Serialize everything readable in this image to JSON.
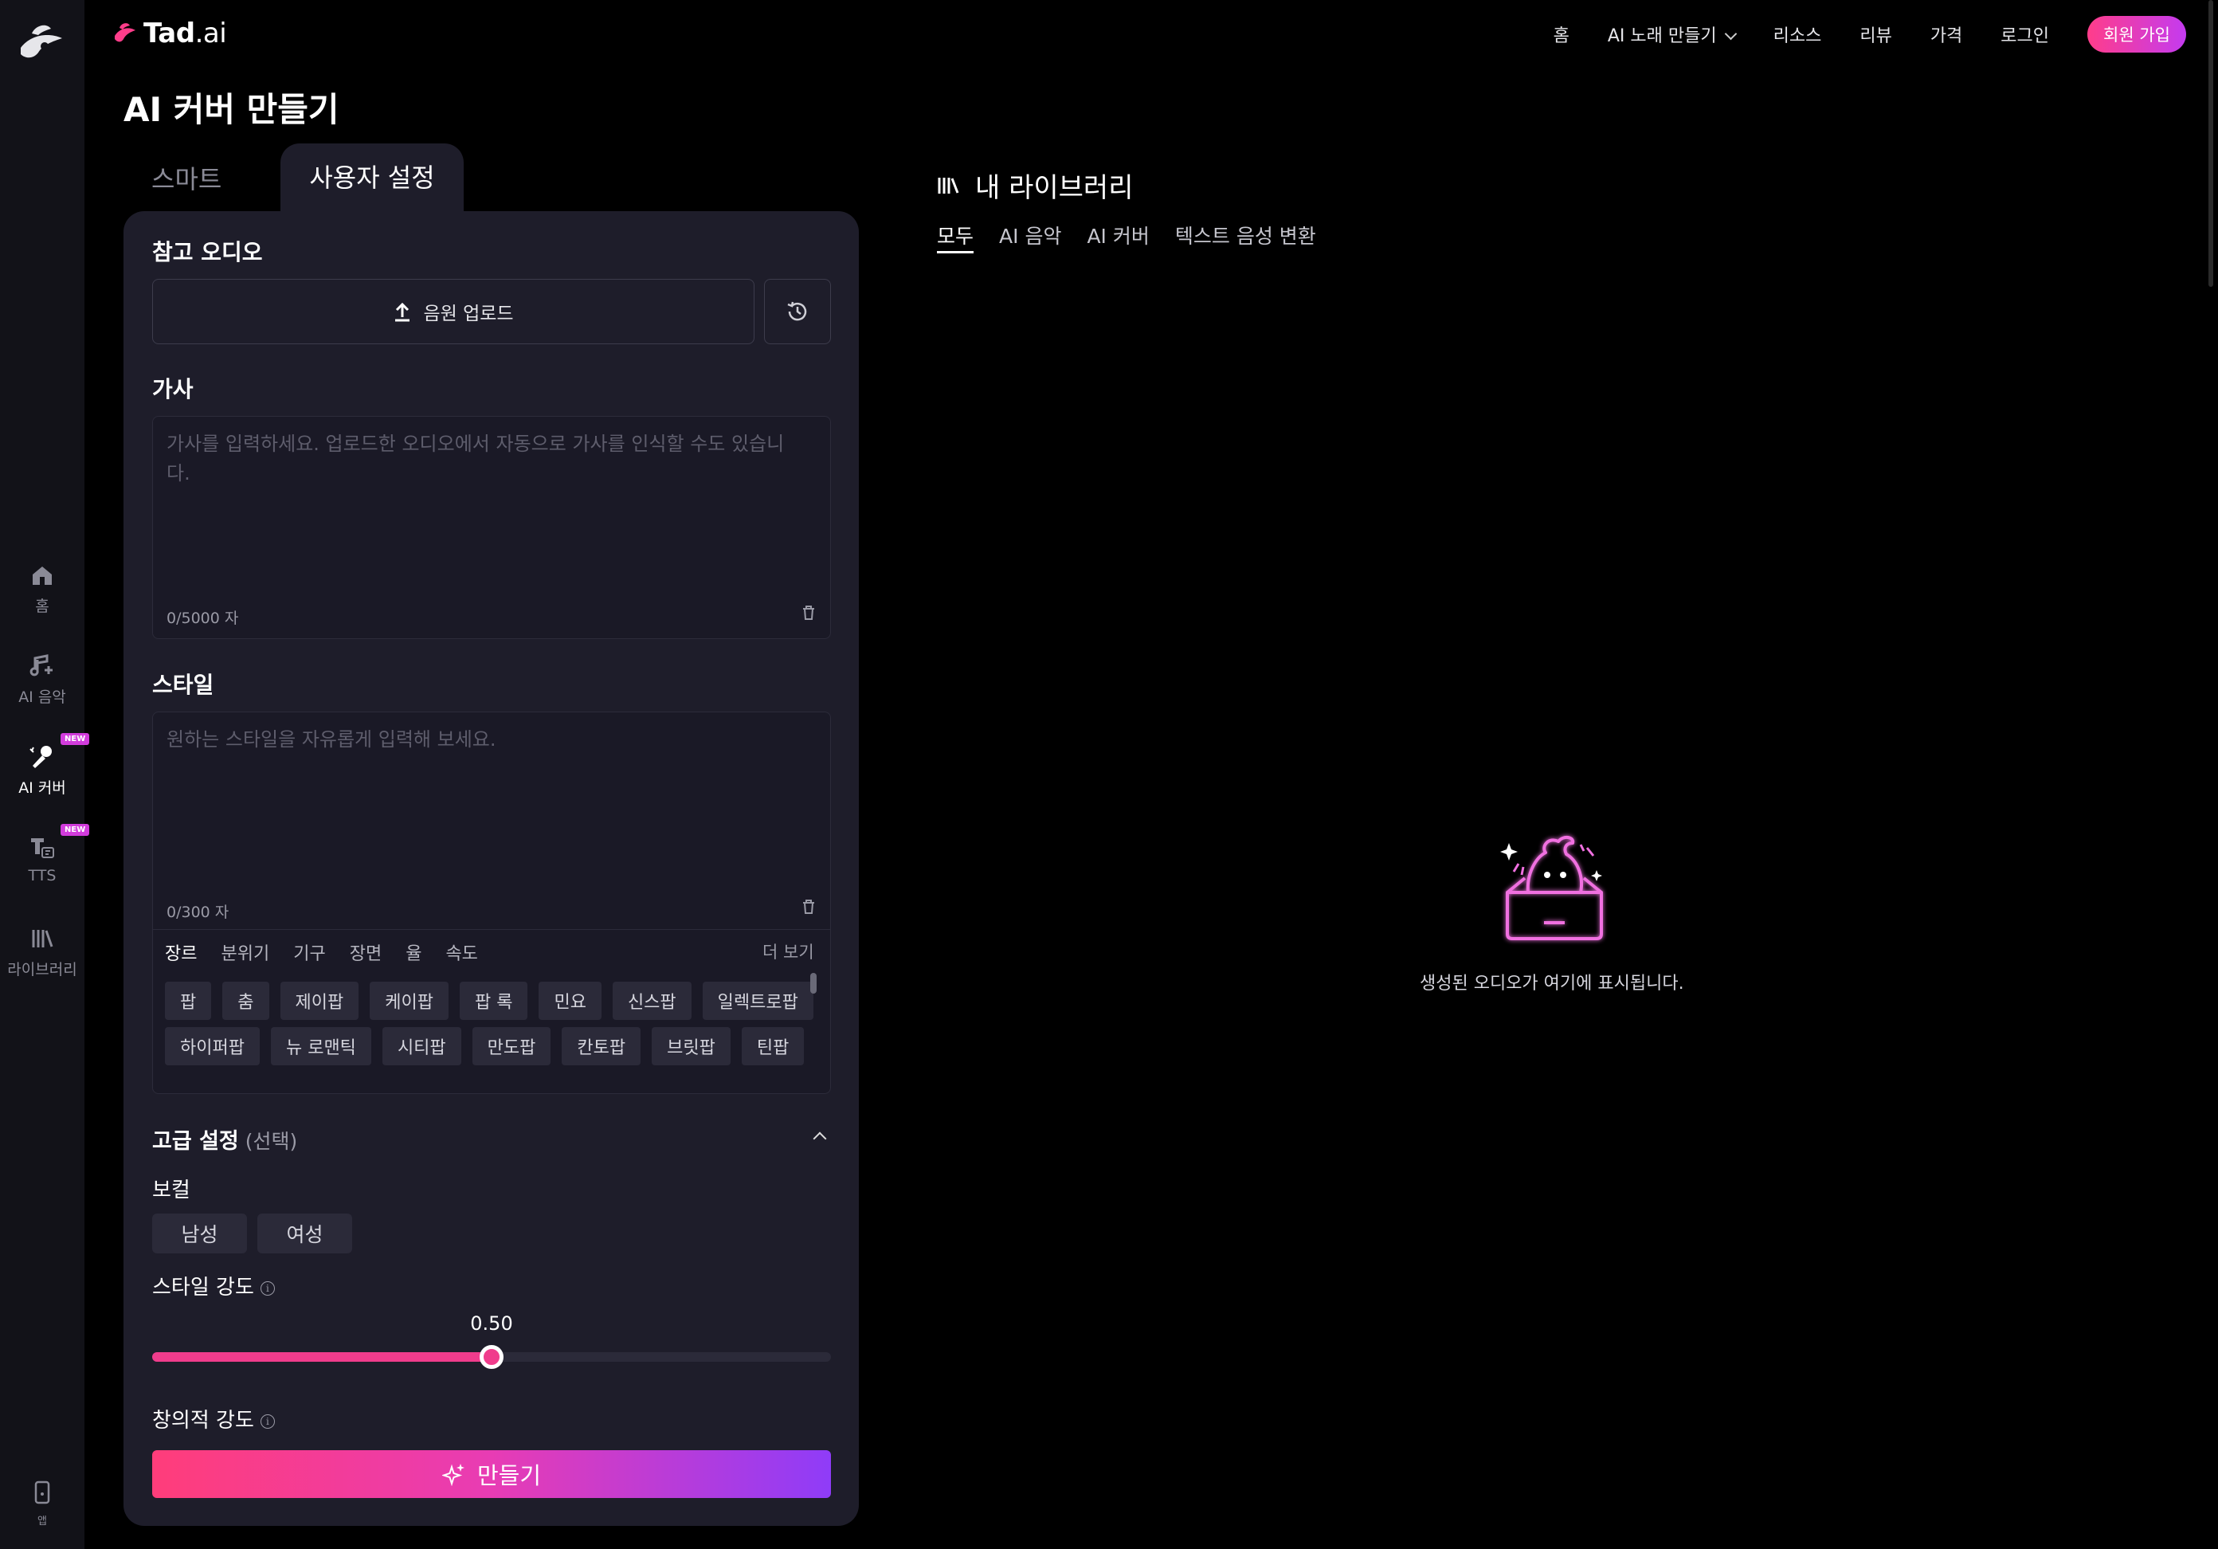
{
  "brand": {
    "name": "Tad",
    "suffix": ".ai"
  },
  "nav": {
    "home": "홈",
    "ai_song": "AI 노래 만들기",
    "resources": "리소스",
    "reviews": "리뷰",
    "pricing": "가격",
    "login": "로그인",
    "signup": "회원 가입"
  },
  "sidebar": {
    "items": [
      {
        "label": "홈",
        "icon": "home-icon"
      },
      {
        "label": "AI 음악",
        "icon": "music-note-icon"
      },
      {
        "label": "AI 커버",
        "icon": "microphone-icon",
        "badge": "NEW"
      },
      {
        "label": "TTS",
        "icon": "tts-icon",
        "badge": "NEW"
      },
      {
        "label": "라이브러리",
        "icon": "library-icon"
      }
    ],
    "app_label": "앱"
  },
  "page": {
    "title": "AI 커버 만들기"
  },
  "mode_tabs": {
    "smart": "스마트",
    "custom": "사용자 설정"
  },
  "form": {
    "reference_audio": {
      "label": "참고 오디오",
      "upload": "음원 업로드"
    },
    "lyrics": {
      "label": "가사",
      "placeholder": "가사를 입력하세요. 업로드한 오디오에서 자동으로 가사를 인식할 수도 있습니다.",
      "counter": "0/5000 자"
    },
    "style": {
      "label": "스타일",
      "placeholder": "원하는 스타일을 자유롭게 입력해 보세요.",
      "counter": "0/300 자",
      "tabs": [
        "장르",
        "분위기",
        "기구",
        "장면",
        "율",
        "속도"
      ],
      "more": "더 보기",
      "chips_row1": [
        "팝",
        "춤",
        "제이팝",
        "케이팝",
        "팝 록",
        "민요",
        "신스팝",
        "일렉트로팝"
      ],
      "chips_row2": [
        "하이퍼팝",
        "뉴 로맨틱",
        "시티팝",
        "만도팝",
        "칸토팝",
        "브릿팝",
        "틴팝"
      ]
    },
    "advanced": {
      "label": "고급 설정",
      "optional": "(선택)",
      "vocal_label": "보컬",
      "vocal_male": "남성",
      "vocal_female": "여성",
      "style_strength_label": "스타일 강도",
      "style_strength_value": "0.50",
      "style_strength_fraction": 0.5,
      "creativity_label": "창의적 강도"
    },
    "create": "만들기"
  },
  "library": {
    "title": "내 라이브러리",
    "tabs": [
      "모두",
      "AI 음악",
      "AI 커버",
      "텍스트 음성 변환"
    ],
    "empty_text": "생성된 오디오가 여기에 표시됩니다."
  },
  "colors": {
    "accent_pink": "#f03c8c",
    "accent_purple": "#8f3cf8",
    "panel": "#1e1d2a"
  }
}
